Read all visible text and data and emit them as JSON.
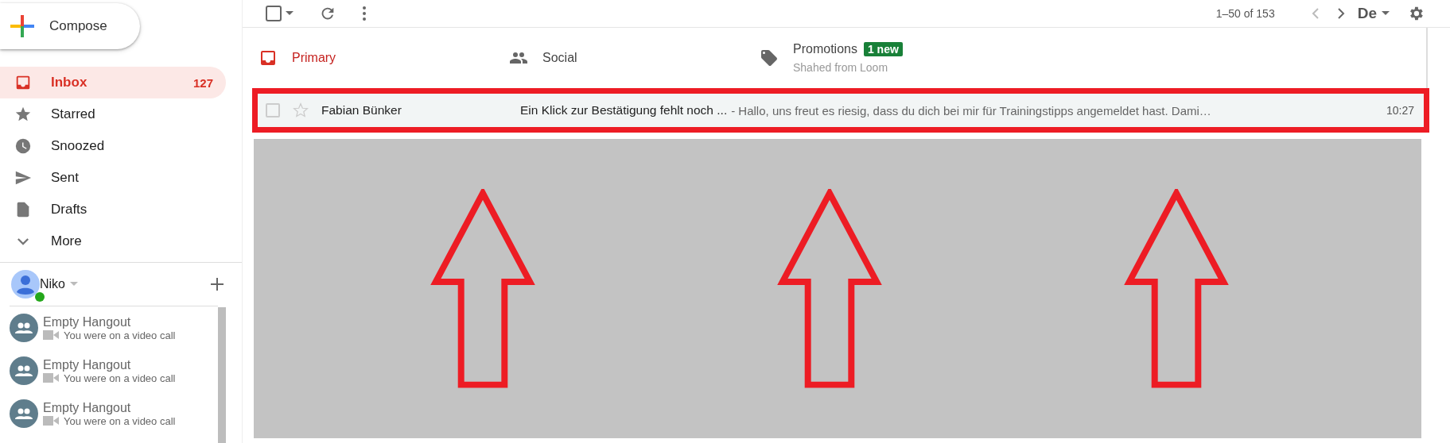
{
  "sidebar": {
    "compose": {
      "label": "Compose"
    },
    "items": [
      {
        "kind": "inbox",
        "label": "Inbox",
        "count": "127",
        "selected": true
      },
      {
        "kind": "star",
        "label": "Starred",
        "selected": false
      },
      {
        "kind": "clock",
        "label": "Snoozed",
        "selected": false
      },
      {
        "kind": "send",
        "label": "Sent",
        "selected": false
      },
      {
        "kind": "file",
        "label": "Drafts",
        "selected": false
      },
      {
        "kind": "chevron",
        "label": "More",
        "selected": false
      }
    ],
    "hangouts": {
      "user": "Niko",
      "online": true,
      "conversations": [
        {
          "title": "Empty Hangout",
          "subtitle": "You were on a video call"
        },
        {
          "title": "Empty Hangout",
          "subtitle": "You were on a video call"
        },
        {
          "title": "Empty Hangout",
          "subtitle": "You were on a video call"
        }
      ]
    }
  },
  "toolbar": {
    "select_all_checked": false,
    "pagination": "1–50 of 153",
    "input_tool": "De"
  },
  "tabs": [
    {
      "kind": "inbox",
      "label": "Primary",
      "selected": true
    },
    {
      "kind": "people",
      "label": "Social",
      "selected": false
    },
    {
      "kind": "tag",
      "label": "Promotions",
      "badge": "1 new",
      "subtitle": "Shahed from Loom",
      "selected": false
    }
  ],
  "emails": [
    {
      "sender": "Fabian Bünker",
      "subject": "Ein Klick zur Bestätigung fehlt noch ...",
      "snippet": "- Hallo, uns freut es riesig, dass du dich bei mir für Trainingstipps angemeldet hast. Dami…",
      "time": "10:27",
      "checked": false,
      "starred": false,
      "highlighted": true
    }
  ],
  "annotations": [
    {
      "kind": "up-arrow"
    },
    {
      "kind": "up-arrow"
    },
    {
      "kind": "up-arrow"
    }
  ]
}
